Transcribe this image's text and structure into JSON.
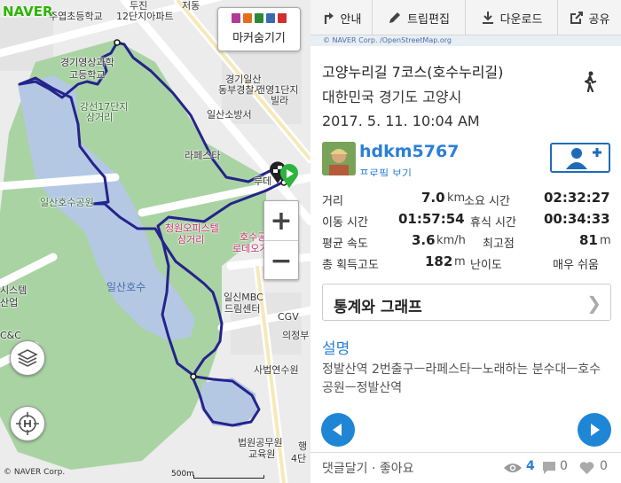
{
  "map": {
    "brand": "NAVER",
    "markers_button_label": "마커숨기기",
    "zoom_in": "+",
    "zoom_out": "−",
    "copyright": "© NAVER Corp.",
    "scale_label": "500m",
    "labels": [
      {
        "text": "두진",
        "kind": "normal"
      },
      {
        "text": "주엽초등학교",
        "kind": "normal"
      },
      {
        "text": "12단지아파트",
        "kind": "normal"
      },
      {
        "text": "경기영상과학",
        "kind": "normal"
      },
      {
        "text": "고등학교",
        "kind": "normal"
      },
      {
        "text": "강선17단지",
        "kind": "park"
      },
      {
        "text": "삼거리",
        "kind": "park"
      },
      {
        "text": "경기일산",
        "kind": "normal"
      },
      {
        "text": "동부경찰서",
        "kind": "normal"
      },
      {
        "text": "건영1단지",
        "kind": "normal"
      },
      {
        "text": "빌라",
        "kind": "normal"
      },
      {
        "text": "일산소방서",
        "kind": "normal"
      },
      {
        "text": "라페스타",
        "kind": "normal"
      },
      {
        "text": "일산호수공원",
        "kind": "park"
      },
      {
        "text": "청원오피스텔",
        "kind": "pink"
      },
      {
        "text": "삼거리",
        "kind": "pink"
      },
      {
        "text": "호수공원",
        "kind": "pink"
      },
      {
        "text": "로데오거리",
        "kind": "pink"
      },
      {
        "text": "일산호수",
        "kind": "water"
      },
      {
        "text": "시스템",
        "kind": "normal"
      },
      {
        "text": "산업",
        "kind": "normal"
      },
      {
        "text": "C&C",
        "kind": "normal"
      },
      {
        "text": "일신MBC",
        "kind": "normal"
      },
      {
        "text": "드림센터",
        "kind": "normal"
      },
      {
        "text": "CGV",
        "kind": "normal"
      },
      {
        "text": "의정부",
        "kind": "normal"
      },
      {
        "text": "사법연수원",
        "kind": "normal"
      },
      {
        "text": "법원공무원",
        "kind": "normal"
      },
      {
        "text": "교육원",
        "kind": "normal"
      },
      {
        "text": "저동",
        "kind": "normal"
      },
      {
        "text": "루데",
        "kind": "normal"
      },
      {
        "text": "행",
        "kind": "normal"
      },
      {
        "text": "4단",
        "kind": "normal"
      }
    ]
  },
  "toolbar": {
    "guide": "안내",
    "trip_edit": "트립편집",
    "download": "다운로드",
    "share": "공유"
  },
  "map_strip_text": "© NAVER Corp. /OpenStreetMap.org",
  "route": {
    "title": "고양누리길 7코스(호수누리길)",
    "region": "대한민국 경기도 고양시",
    "date": "2017. 5. 11. 10:04 AM",
    "activity_icon": "walking-icon"
  },
  "user": {
    "name": "hdkm5767",
    "profile_link": "프로필 보기"
  },
  "stats": {
    "distance_label": "거리",
    "distance_value": "7.0",
    "distance_unit": "km",
    "duration_label": "소요 시간",
    "duration_value": "02:32:27",
    "moving_label": "이동 시간",
    "moving_value": "01:57:54",
    "rest_label": "휴식 시간",
    "rest_value": "00:34:33",
    "speed_label": "평균 속도",
    "speed_value": "3.6",
    "speed_unit": "km/h",
    "max_alt_label": "최고점",
    "max_alt_value": "81",
    "max_alt_unit": "m",
    "gain_label": "총 획득고도",
    "gain_value": "182",
    "gain_unit": "m",
    "difficulty_label": "난이도",
    "difficulty_value": "매우 쉬움"
  },
  "stats_graph_button": "통계와 그래프",
  "description": {
    "heading": "설명",
    "text": "정발산역 2번출구ㅡ라페스타ㅡ노래하는 분수대ㅡ호수공원ㅡ정발산역"
  },
  "footer": {
    "comment_like": "댓글달기 · 좋아요",
    "views": "4",
    "comments": "0",
    "likes": "0"
  },
  "colors": {
    "accent_blue": "#2b7fd6",
    "route_line": "#2a2a9a",
    "naver_green": "#2db400",
    "park_green": "#8fc58b",
    "lake_blue": "#b4c8e4"
  }
}
